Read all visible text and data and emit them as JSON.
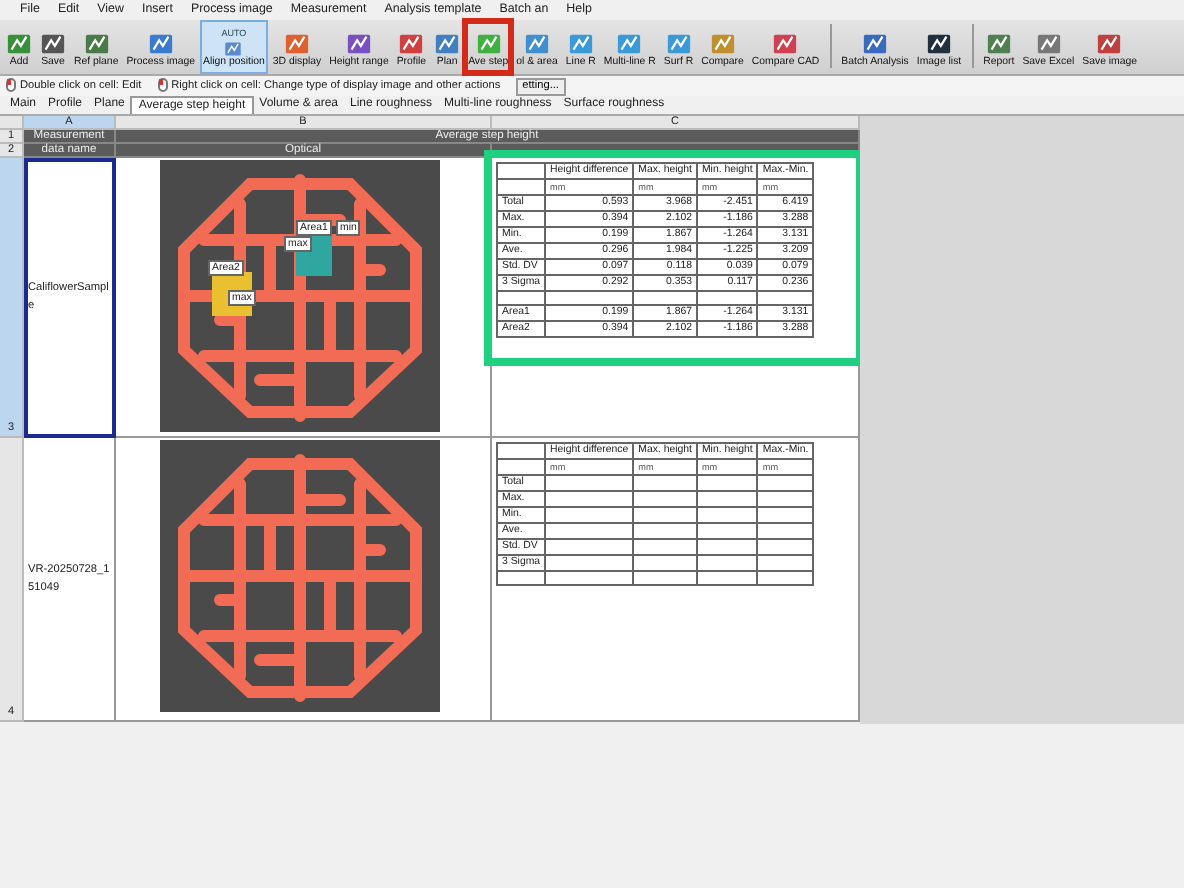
{
  "menu": [
    "File",
    "Edit",
    "View",
    "Insert",
    "Process image",
    "Measurement",
    "Analysis template",
    "Batch an",
    "Help"
  ],
  "toolbar": [
    {
      "items": [
        {
          "label": "Add",
          "pressed": false,
          "highlighted": false,
          "color": "#3a8f3a"
        },
        {
          "label": "Save",
          "pressed": false,
          "highlighted": false,
          "color": "#555555"
        },
        {
          "label": "Ref plane",
          "pressed": false,
          "highlighted": false,
          "color": "#4a7a4a"
        },
        {
          "label": "Process image",
          "pressed": false,
          "highlighted": false,
          "color": "#3a7ad0"
        },
        {
          "label": "Align position",
          "badge": "AUTO",
          "pressed": true,
          "highlighted": false,
          "color": "#5a8ad0"
        },
        {
          "label": "3D display",
          "pressed": false,
          "highlighted": false,
          "color": "#e06030"
        },
        {
          "label": "Height range",
          "pressed": false,
          "highlighted": false,
          "color": "#7a50c0"
        },
        {
          "label": "Profile",
          "pressed": false,
          "highlighted": false,
          "color": "#d04040"
        },
        {
          "label": "Plan",
          "pressed": false,
          "highlighted": false,
          "color": "#4080c0"
        },
        {
          "label": "Ave step",
          "pressed": false,
          "highlighted": true,
          "color": "#40b040"
        },
        {
          "label": "ol & area",
          "pressed": false,
          "highlighted": false,
          "color": "#4090d0"
        },
        {
          "label": "Line R",
          "pressed": false,
          "highlighted": false,
          "color": "#3a9ad8"
        },
        {
          "label": "Multi-line R",
          "pressed": false,
          "highlighted": false,
          "color": "#3a9ad8"
        },
        {
          "label": "Surf R",
          "pressed": false,
          "highlighted": false,
          "color": "#3a9ad8"
        },
        {
          "label": "Compare",
          "pressed": false,
          "highlighted": false,
          "color": "#c09030"
        },
        {
          "label": "Compare CAD",
          "pressed": false,
          "highlighted": false,
          "color": "#d04050"
        }
      ]
    },
    {
      "items": [
        {
          "label": "Batch Analysis",
          "pressed": false,
          "highlighted": false,
          "color": "#3a6ac0"
        },
        {
          "label": "Image list",
          "pressed": false,
          "highlighted": false,
          "color": "#203040"
        }
      ]
    },
    {
      "items": [
        {
          "label": "Report",
          "pressed": false,
          "highlighted": false,
          "color": "#508050"
        },
        {
          "label": "Save Excel",
          "pressed": false,
          "highlighted": false,
          "color": "#777777"
        },
        {
          "label": "Save image",
          "pressed": false,
          "highlighted": false,
          "color": "#c04040"
        }
      ]
    }
  ],
  "hints": [
    "Double click on cell: Edit",
    "Right click on cell: Change type of display image and other actions"
  ],
  "hint_button": "etting...",
  "tabs": [
    {
      "label": "Main",
      "selected": false
    },
    {
      "label": "Profile",
      "selected": false
    },
    {
      "label": "Plane",
      "selected": false
    },
    {
      "label": "Average step height",
      "selected": true
    },
    {
      "label": "Volume & area",
      "selected": false
    },
    {
      "label": "Line roughness",
      "selected": false
    },
    {
      "label": "Multi-line roughness",
      "selected": false
    },
    {
      "label": "Surface roughness",
      "selected": false
    }
  ],
  "sheet": {
    "columns": [
      {
        "label": "A",
        "selected": true
      },
      {
        "label": "B",
        "selected": false
      },
      {
        "label": "C",
        "selected": false
      }
    ],
    "header_row1": {
      "measurement": "Measurement",
      "group": "Average step height"
    },
    "header_row2": {
      "measurement": "data name",
      "image": "Optical"
    },
    "rows": [
      {
        "number": "1"
      },
      {
        "number": "2"
      },
      {
        "number": "3",
        "selected": true,
        "name": "CaliflowerSample",
        "highlighted": true,
        "overlays": [
          {
            "kind": "area",
            "label": "Area1",
            "color": "#2fa7a0"
          },
          {
            "kind": "area",
            "label": "Area2",
            "color": "#e8c030"
          }
        ],
        "marks": [
          "min",
          "max",
          "max"
        ],
        "table": {
          "columns": [
            "Height difference",
            "Max. height",
            "Min. height",
            "Max.-Min."
          ],
          "units": [
            "mm",
            "mm",
            "mm",
            "mm"
          ],
          "rows": [
            [
              "Total",
              "0.593",
              "3.968",
              "-2.451",
              "6.419"
            ],
            [
              "Max.",
              "0.394",
              "2.102",
              "-1.186",
              "3.288"
            ],
            [
              "Min.",
              "0.199",
              "1.867",
              "-1.264",
              "3.131"
            ],
            [
              "Ave.",
              "0.296",
              "1.984",
              "-1.225",
              "3.209"
            ],
            [
              "Std. DV",
              "0.097",
              "0.118",
              "0.039",
              "0.079"
            ],
            [
              "3 Sigma",
              "0.292",
              "0.353",
              "0.117",
              "0.236"
            ],
            null,
            [
              "Area1",
              "0.199",
              "1.867",
              "-1.264",
              "3.131"
            ],
            [
              "Area2",
              "0.394",
              "2.102",
              "-1.186",
              "3.288"
            ]
          ]
        }
      },
      {
        "number": "4",
        "selected": false,
        "name": "VR-20250728_151049",
        "overlays": [],
        "marks": [],
        "table": {
          "columns": [
            "Height difference",
            "Max. height",
            "Min. height",
            "Max.-Min."
          ],
          "units": [
            "mm",
            "mm",
            "mm",
            "mm"
          ],
          "rows": [
            [
              "Total"
            ],
            [
              "Max."
            ],
            [
              "Min."
            ],
            [
              "Ave."
            ],
            [
              "Std. DV"
            ],
            [
              "3 Sigma"
            ],
            null
          ]
        }
      }
    ]
  }
}
